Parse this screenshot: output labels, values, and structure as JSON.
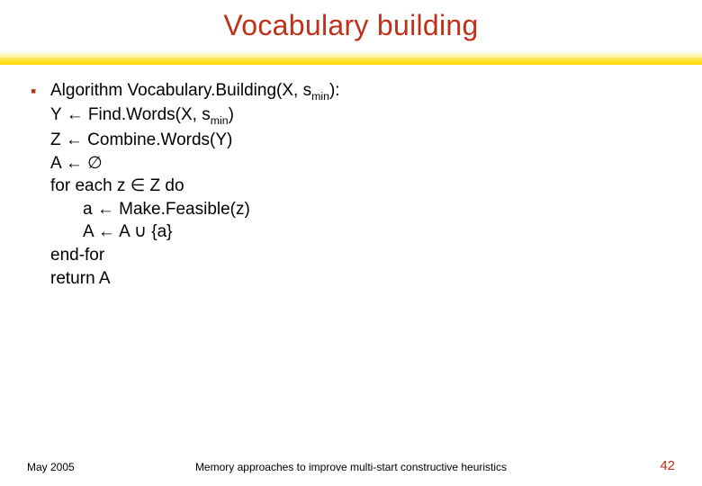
{
  "title": "Vocabulary building",
  "algo": {
    "header_pre": "Algorithm Vocabulary.Building(X, s",
    "header_sub": "min",
    "header_post": "):",
    "l1_pre": "Y ← Find.Words(X, s",
    "l1_sub": "min",
    "l1_post": ")",
    "l2": "Z ← Combine.Words(Y)",
    "l3": "A ← ∅",
    "l4": "for each z ∈ Z do",
    "l5": "a ← Make.Feasible(z)",
    "l6": "A ← A ∪ {a}",
    "l7": "end-for",
    "l8": "return A"
  },
  "footer": {
    "date": "May 2005",
    "caption": "Memory approaches to improve multi-start constructive heuristics",
    "page": "42"
  }
}
